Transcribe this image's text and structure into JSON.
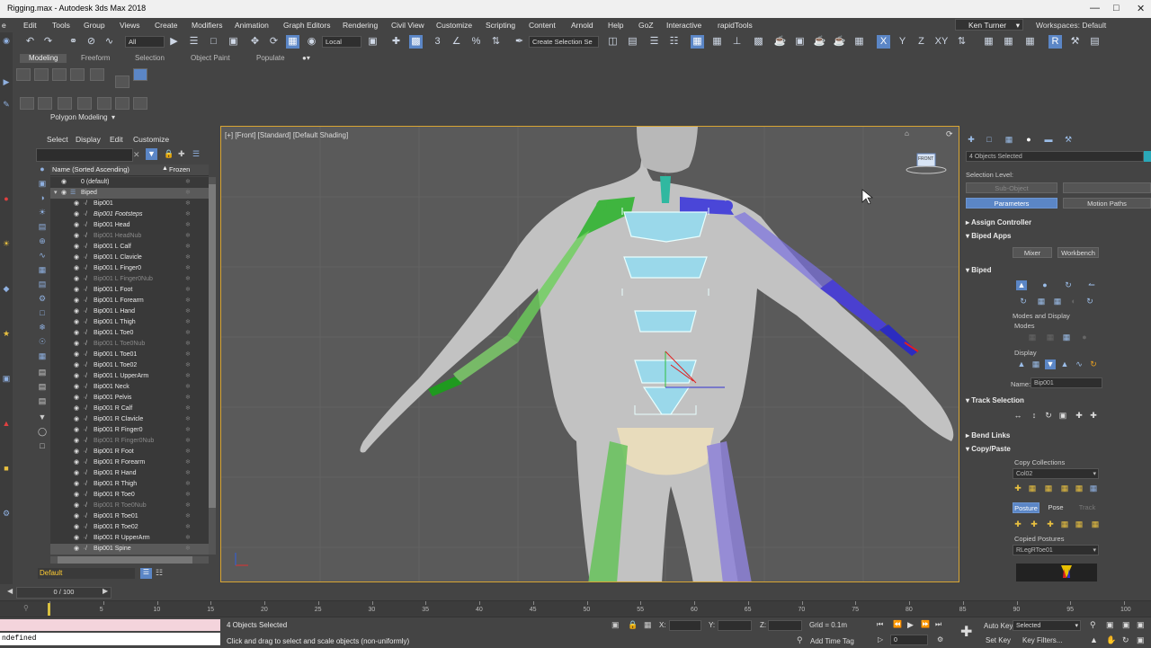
{
  "window": {
    "title": "Rigging.max - Autodesk 3ds Max 2018"
  },
  "menu": [
    "e",
    "Edit",
    "Tools",
    "Group",
    "Views",
    "Create",
    "Modifiers",
    "Animation",
    "Graph Editors",
    "Rendering",
    "Civil View",
    "Customize",
    "Scripting",
    "Content",
    "Arnold",
    "Help",
    "GoZ",
    "Interactive",
    "rapidTools"
  ],
  "user": {
    "name": "Ken Turner",
    "workspace": "Workspaces: Default"
  },
  "toolbar": {
    "filter": "All",
    "coord": "Local",
    "selection_set": "Create Selection Se",
    "axes": [
      "X",
      "Y",
      "Z",
      "XY"
    ]
  },
  "ribbon": {
    "tabs": [
      "Modeling",
      "Freeform",
      "Selection",
      "Object Paint",
      "Populate"
    ],
    "panel": "Polygon Modeling"
  },
  "explorer": {
    "menu": [
      "Select",
      "Display",
      "Edit",
      "Customize"
    ],
    "col_name": "Name (Sorted Ascending)",
    "col_frozen": "Frozen",
    "rows": [
      {
        "label": "0 (default)",
        "indent": 0
      },
      {
        "label": "Biped",
        "indent": 1,
        "sel": true
      },
      {
        "label": "Bip001",
        "indent": 2
      },
      {
        "label": "Bip001 Footsteps",
        "indent": 2,
        "italic": true
      },
      {
        "label": "Bip001 Head",
        "indent": 2
      },
      {
        "label": "Bip001 HeadNub",
        "indent": 2,
        "dim": true
      },
      {
        "label": "Bip001 L Calf",
        "indent": 2
      },
      {
        "label": "Bip001 L Clavicle",
        "indent": 2
      },
      {
        "label": "Bip001 L Finger0",
        "indent": 2
      },
      {
        "label": "Bip001 L Finger0Nub",
        "indent": 2,
        "dim": true
      },
      {
        "label": "Bip001 L Foot",
        "indent": 2
      },
      {
        "label": "Bip001 L Forearm",
        "indent": 2
      },
      {
        "label": "Bip001 L Hand",
        "indent": 2
      },
      {
        "label": "Bip001 L Thigh",
        "indent": 2
      },
      {
        "label": "Bip001 L Toe0",
        "indent": 2
      },
      {
        "label": "Bip001 L Toe0Nub",
        "indent": 2,
        "dim": true
      },
      {
        "label": "Bip001 L Toe01",
        "indent": 2
      },
      {
        "label": "Bip001 L Toe02",
        "indent": 2
      },
      {
        "label": "Bip001 L UpperArm",
        "indent": 2
      },
      {
        "label": "Bip001 Neck",
        "indent": 2
      },
      {
        "label": "Bip001 Pelvis",
        "indent": 2
      },
      {
        "label": "Bip001 R Calf",
        "indent": 2
      },
      {
        "label": "Bip001 R Clavicle",
        "indent": 2
      },
      {
        "label": "Bip001 R Finger0",
        "indent": 2
      },
      {
        "label": "Bip001 R Finger0Nub",
        "indent": 2,
        "dim": true
      },
      {
        "label": "Bip001 R Foot",
        "indent": 2
      },
      {
        "label": "Bip001 R Forearm",
        "indent": 2
      },
      {
        "label": "Bip001 R Hand",
        "indent": 2
      },
      {
        "label": "Bip001 R Thigh",
        "indent": 2
      },
      {
        "label": "Bip001 R Toe0",
        "indent": 2
      },
      {
        "label": "Bip001 R Toe0Nub",
        "indent": 2,
        "dim": true
      },
      {
        "label": "Bip001 R Toe01",
        "indent": 2
      },
      {
        "label": "Bip001 R Toe02",
        "indent": 2
      },
      {
        "label": "Bip001 R UpperArm",
        "indent": 2
      },
      {
        "label": "Bip001 Spine",
        "indent": 2,
        "sel": true
      }
    ],
    "layer": "Default"
  },
  "viewport": {
    "label": "[+] [Front] [Standard] [Default Shading]",
    "cube_label": "FRONT"
  },
  "cmd": {
    "objects_selected": "4 Objects Selected",
    "selection_level": "Selection Level:",
    "sub_object": "Sub-Object",
    "tab_params": "Parameters",
    "tab_motion": "Motion Paths",
    "assign_controller": "Assign Controller",
    "biped_apps": "Biped Apps",
    "mixer": "Mixer",
    "workbench": "Workbench",
    "biped": "Biped",
    "modes_display": "Modes and Display",
    "modes": "Modes",
    "display": "Display",
    "name_label": "Name:",
    "name_value": "Bip001",
    "track_selection": "Track Selection",
    "bend_links": "Bend Links",
    "copy_paste": "Copy/Paste",
    "copy_collections": "Copy Collections",
    "collection": "Col02",
    "posture": "Posture",
    "pose": "Pose",
    "track": "Track",
    "copied_postures": "Copied Postures",
    "copied_value": "RLegRToe01"
  },
  "timeline": {
    "frame": "0 / 100",
    "ticks": [
      0,
      5,
      10,
      15,
      20,
      25,
      30,
      35,
      40,
      45,
      50,
      55,
      60,
      65,
      70,
      75,
      80,
      85,
      90,
      95,
      100
    ]
  },
  "status": {
    "script": "ndefined",
    "selected": "4 Objects Selected",
    "prompt": "Click and drag to select and scale objects (non-uniformly)",
    "x_label": "X:",
    "y_label": "Y:",
    "z_label": "Z:",
    "grid": "Grid = 0.1m",
    "add_time_tag": "Add Time Tag",
    "auto_key": "Auto Key",
    "set_key": "Set Key",
    "selected_dd": "Selected",
    "key_filters": "Key Filters...",
    "frame_value": "0"
  },
  "colors": {
    "accent": "#5b86c6",
    "left_limb": "#4caf3a",
    "right_limb": "#5a4fd0",
    "spine": "#8ad2e6",
    "viewport_border": "#d8a533"
  }
}
